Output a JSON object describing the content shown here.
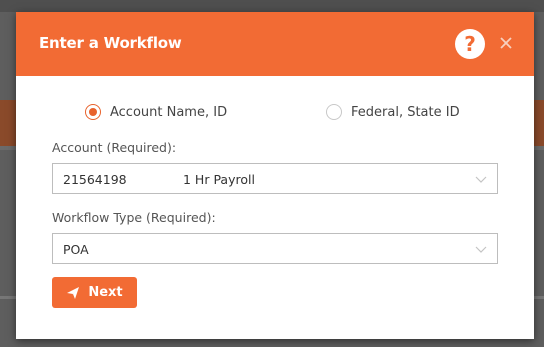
{
  "dialog": {
    "title": "Enter a Workflow",
    "help_icon": "question-circle-icon",
    "close_icon": "close-icon"
  },
  "search_mode": {
    "options": [
      {
        "label": "Account Name, ID",
        "selected": true
      },
      {
        "label": "Federal, State ID",
        "selected": false
      }
    ]
  },
  "account": {
    "label": "Account (Required):",
    "value_id": "21564198",
    "value_name": "1 Hr Payroll"
  },
  "workflow_type": {
    "label": "Workflow Type (Required):",
    "value": "POA"
  },
  "next_button": {
    "label": "Next",
    "icon": "paper-plane-icon"
  },
  "colors": {
    "accent": "#f26b34",
    "radio_selected": "#e8622c"
  }
}
